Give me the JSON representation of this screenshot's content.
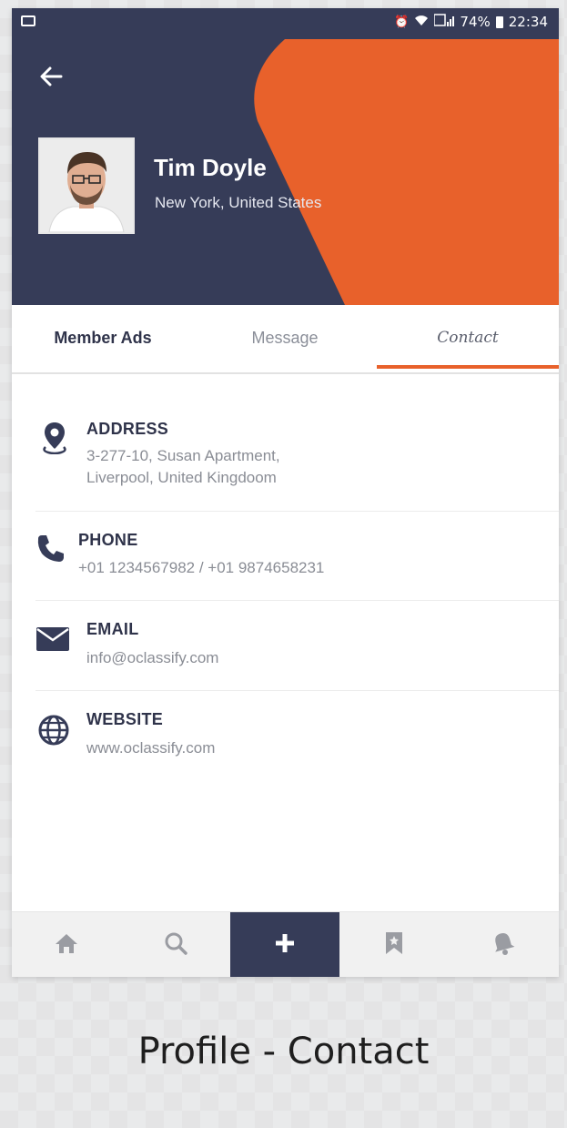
{
  "status_bar": {
    "battery": "74%",
    "time": "22:34"
  },
  "profile": {
    "name": "Tim Doyle",
    "location": "New York, United States"
  },
  "tabs": [
    {
      "label": "Member Ads",
      "active": false
    },
    {
      "label": "Message",
      "active": false
    },
    {
      "label": "Contact",
      "active": true
    }
  ],
  "contact": {
    "address": {
      "label": "ADDRESS",
      "line1": "3-277-10, Susan Apartment,",
      "line2": "Liverpool, United Kingdoom",
      "icon": "location-pin-icon"
    },
    "phone": {
      "label": "PHONE",
      "value": "+01 1234567982 / +01 9874658231",
      "icon": "phone-icon"
    },
    "email": {
      "label": "EMAIL",
      "value": "info@oclassify.com",
      "icon": "mail-icon"
    },
    "website": {
      "label": "WEBSITE",
      "value": "www.oclassify.com",
      "icon": "globe-icon"
    }
  },
  "bottom_nav": [
    "home-icon",
    "search-icon",
    "plus-icon",
    "bookmark-icon",
    "notification-bell-icon"
  ],
  "colors": {
    "navy": "#363c58",
    "accent": "#e8612b",
    "text_dark": "#2f334a",
    "text_muted": "#8a8d95"
  },
  "caption": "Profile - Contact"
}
